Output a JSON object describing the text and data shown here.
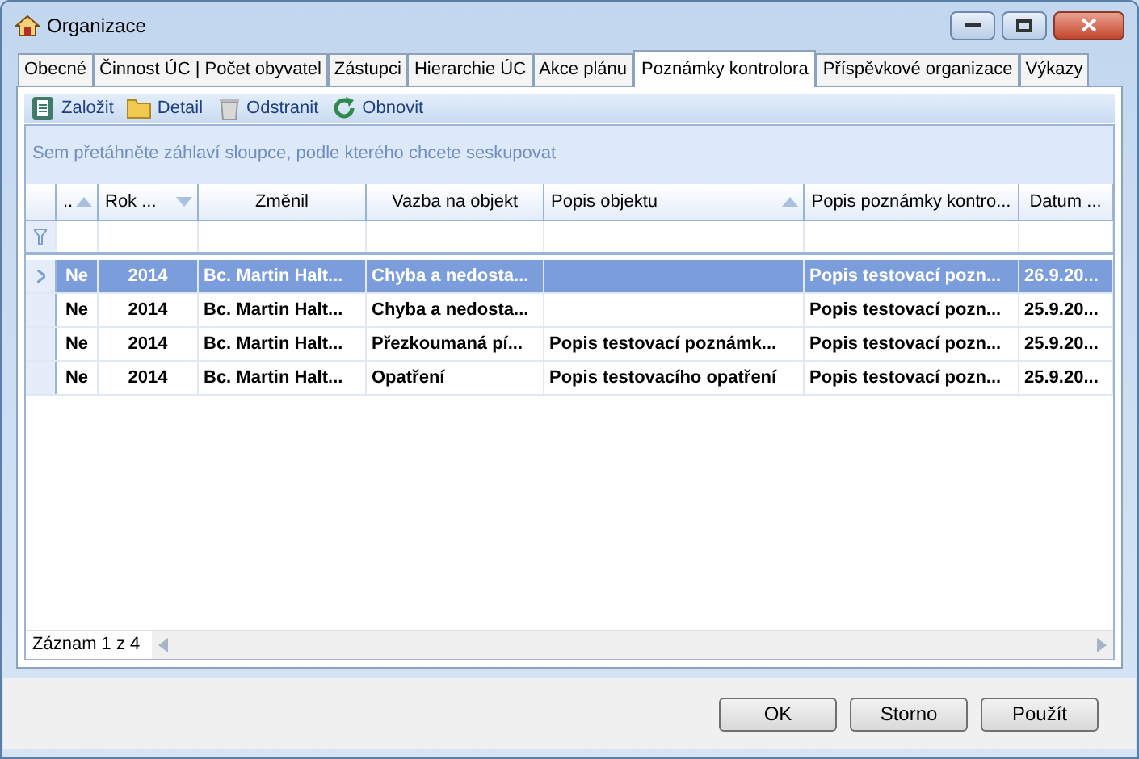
{
  "window": {
    "title": "Organizace"
  },
  "tabs": [
    {
      "label": "Obecné",
      "selected": false
    },
    {
      "label": "Činnost ÚC | Počet obyvatel",
      "selected": false
    },
    {
      "label": "Zástupci",
      "selected": false
    },
    {
      "label": "Hierarchie ÚC",
      "selected": false
    },
    {
      "label": "Akce plánu",
      "selected": false
    },
    {
      "label": "Poznámky kontrolora",
      "selected": true
    },
    {
      "label": "Příspěvkové organizace",
      "selected": false
    },
    {
      "label": "Výkazy",
      "selected": false
    }
  ],
  "toolbar": [
    {
      "kind": "new",
      "label": "Založit",
      "disabled": false
    },
    {
      "kind": "folder",
      "label": "Detail",
      "disabled": false
    },
    {
      "kind": "trash",
      "label": "Odstranit",
      "disabled": false
    },
    {
      "kind": "refresh",
      "label": "Obnovit",
      "disabled": false
    }
  ],
  "group_panel": {
    "hint": "Sem přetáhněte záhlaví sloupce, podle kterého chcete seskupovat"
  },
  "table": {
    "columns": [
      {
        "label": "..",
        "sorted": true,
        "descending": false
      },
      {
        "label": "Rok ...",
        "sorted": true,
        "descending": true
      },
      {
        "label": "Změnil",
        "sorted": false
      },
      {
        "label": "Vazba na objekt",
        "sorted": false
      },
      {
        "label": "Popis objektu",
        "sorted": true,
        "descending": false
      },
      {
        "label": "Popis poznámky kontro...",
        "sorted": false
      },
      {
        "label": "Datum ...",
        "sorted": false
      }
    ],
    "rows": [
      {
        "selected": true,
        "cells": [
          "Ne",
          "2014",
          "Bc. Martin Halt...",
          "Chyba a nedosta...",
          "",
          "Popis testovací pozn...",
          "26.9.20..."
        ]
      },
      {
        "selected": false,
        "cells": [
          "Ne",
          "2014",
          "Bc. Martin Halt...",
          "Chyba a nedosta...",
          "",
          "Popis testovací pozn...",
          "25.9.20..."
        ]
      },
      {
        "selected": false,
        "cells": [
          "Ne",
          "2014",
          "Bc. Martin Halt...",
          "Přezkoumaná pí...",
          "Popis testovací poznámk...",
          "Popis testovací pozn...",
          "25.9.20..."
        ]
      },
      {
        "selected": false,
        "cells": [
          "Ne",
          "2014",
          "Bc. Martin Halt...",
          "Opatření",
          "Popis testovacího opatření",
          "Popis testovací pozn...",
          "25.9.20..."
        ]
      }
    ],
    "record_counter": "Záznam 1 z 4"
  },
  "buttons": [
    "OK",
    "Storno",
    "Použít"
  ]
}
